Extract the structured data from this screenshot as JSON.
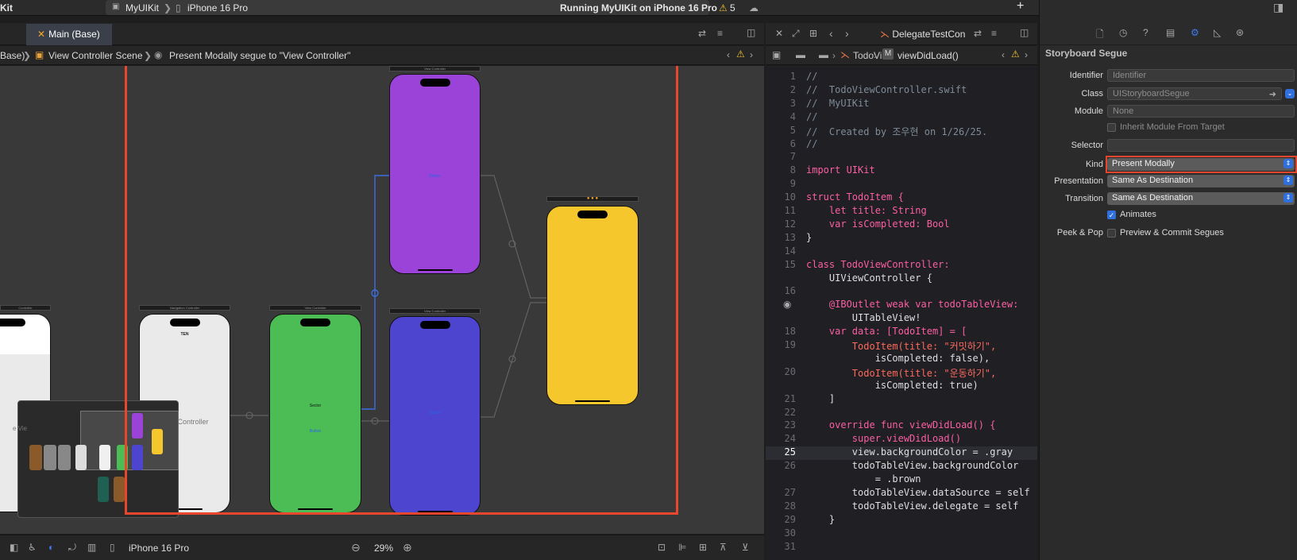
{
  "window": {
    "app_fragment": "Kit",
    "scheme": "MyUIKit",
    "device": "iPhone 16 Pro",
    "status": "Running MyUIKit on iPhone 16 Pro",
    "warning_count": "5"
  },
  "storyboard_tab": {
    "label": "Main (Base)"
  },
  "breadcrumb": {
    "items": [
      "Base)",
      "View Controller Scene",
      "Present Modally segue to \"View Controller\""
    ]
  },
  "canvas": {
    "scenes": [
      {
        "title": "Controller",
        "color": "#ffffff"
      },
      {
        "title": "Navigation Controller",
        "color": "#eaeaea",
        "top_text": "TEN",
        "center_text": "on Controller"
      },
      {
        "title": "View Controller",
        "color": "#4cbc54",
        "top_text": "Sector",
        "link_text": "Button"
      },
      {
        "title": "View Controller",
        "color": "#9b43d8",
        "link_text": "Button"
      },
      {
        "title": "View Controller",
        "color": "#4d45cf",
        "link_text": "Button"
      },
      {
        "title": "",
        "color": "#f5c72d"
      }
    ],
    "overview_text": [
      "e Vie",
      "n Contro"
    ],
    "selection_color": "#e8462d"
  },
  "bottom_bar": {
    "device": "iPhone 16 Pro",
    "zoom": "29%"
  },
  "editor_tab": {
    "label": "DelegateTestCon",
    "jump_path": [
      "TodoVie",
      "viewDidLoad()"
    ]
  },
  "code": {
    "lines": [
      {
        "n": "1",
        "t": "//"
      },
      {
        "n": "2",
        "t": "//  TodoViewController.swift"
      },
      {
        "n": "3",
        "t": "//  MyUIKit"
      },
      {
        "n": "4",
        "t": "//"
      },
      {
        "n": "5",
        "t": "//  Created by 조우현 on 1/26/25."
      },
      {
        "n": "6",
        "t": "//"
      },
      {
        "n": "7",
        "t": ""
      },
      {
        "n": "8",
        "t": "import UIKit"
      },
      {
        "n": "9",
        "t": ""
      },
      {
        "n": "10",
        "t": "struct TodoItem {"
      },
      {
        "n": "11",
        "t": "    let title: String"
      },
      {
        "n": "12",
        "t": "    var isCompleted: Bool"
      },
      {
        "n": "13",
        "t": "}"
      },
      {
        "n": "14",
        "t": ""
      },
      {
        "n": "15",
        "t": "class TodoViewController:"
      },
      {
        "n": "",
        "t": "    UIViewController {"
      },
      {
        "n": "16",
        "t": ""
      },
      {
        "n": "",
        "t": "    @IBOutlet weak var todoTableView:"
      },
      {
        "n": "",
        "t": "        UITableView!"
      },
      {
        "n": "18",
        "t": "    var data: [TodoItem] = ["
      },
      {
        "n": "19",
        "t": "        TodoItem(title: \"커밋하기\","
      },
      {
        "n": "",
        "t": "            isCompleted: false),"
      },
      {
        "n": "20",
        "t": "        TodoItem(title: \"운동하기\","
      },
      {
        "n": "",
        "t": "            isCompleted: true)"
      },
      {
        "n": "21",
        "t": "    ]"
      },
      {
        "n": "22",
        "t": ""
      },
      {
        "n": "23",
        "t": "    override func viewDidLoad() {"
      },
      {
        "n": "24",
        "t": "        super.viewDidLoad()"
      },
      {
        "n": "25",
        "t": "        view.backgroundColor = .gray"
      },
      {
        "n": "26",
        "t": "        todoTableView.backgroundColor"
      },
      {
        "n": "",
        "t": "            = .brown"
      },
      {
        "n": "27",
        "t": "        todoTableView.dataSource = self"
      },
      {
        "n": "28",
        "t": "        todoTableView.delegate = self"
      },
      {
        "n": "29",
        "t": "    }"
      },
      {
        "n": "30",
        "t": ""
      },
      {
        "n": "31",
        "t": ""
      }
    ]
  },
  "inspector": {
    "title": "Storyboard Segue",
    "identifier_label": "Identifier",
    "identifier_placeholder": "Identifier",
    "class_label": "Class",
    "class_value": "UIStoryboardSegue",
    "module_label": "Module",
    "module_value": "None",
    "inherit_label": "Inherit Module From Target",
    "selector_label": "Selector",
    "kind_label": "Kind",
    "kind_value": "Present Modally",
    "presentation_label": "Presentation",
    "presentation_value": "Same As Destination",
    "transition_label": "Transition",
    "transition_value": "Same As Destination",
    "animates_label": "Animates",
    "peek_label": "Peek & Pop",
    "peek_value": "Preview & Commit Segues"
  }
}
